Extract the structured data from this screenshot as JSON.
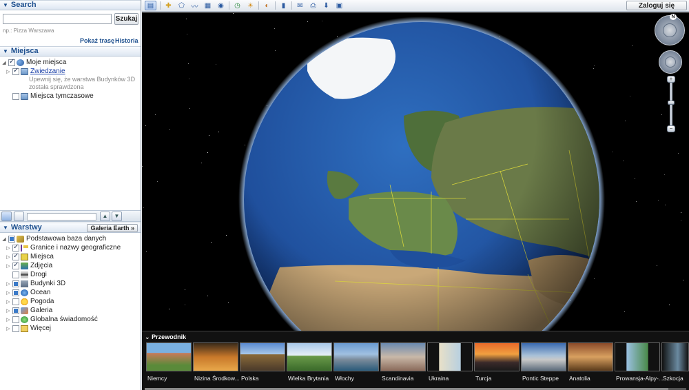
{
  "search": {
    "title": "Search",
    "placeholder": "",
    "button": "Szukaj",
    "hint": "np.: Pizza Warszawa",
    "route_link": "Pokaż trasę",
    "history_link": "Historia"
  },
  "places": {
    "title": "Miejsca",
    "items": [
      {
        "label": "Moje miejsca",
        "checked": true
      },
      {
        "label": "Zwiedzanie",
        "checked": true,
        "link": true
      },
      {
        "label": "Miejsca tymczasowe",
        "checked": false
      }
    ],
    "note_line1": "Upewnij się, że warstwa Budynków 3D",
    "note_line2": "została sprawdzona"
  },
  "layers": {
    "title": "Warstwy",
    "gallery_button": "Galeria Earth »",
    "root": "Podstawowa baza danych",
    "items": [
      {
        "label": "Granice i nazwy geograficzne",
        "checked": true
      },
      {
        "label": "Miejsca",
        "checked": true
      },
      {
        "label": "Zdjęcia",
        "checked": true
      },
      {
        "label": "Drogi",
        "checked": false
      },
      {
        "label": "Budynki 3D",
        "checked": "partial"
      },
      {
        "label": "Ocean",
        "checked": "partial"
      },
      {
        "label": "Pogoda",
        "checked": false
      },
      {
        "label": "Galeria",
        "checked": "partial"
      },
      {
        "label": "Globalna świadomość",
        "checked": false
      },
      {
        "label": "Więcej",
        "checked": false
      }
    ]
  },
  "toolbar": {
    "login": "Zaloguj się"
  },
  "nav": {
    "north": "N",
    "zoom_in": "+",
    "zoom_out": "−"
  },
  "guide": {
    "title": "Przewodnik",
    "tours": [
      "Niemcy",
      "Nizina Środkow...",
      "Polska",
      "Wielka Brytania",
      "Włochy",
      "Scandinavia",
      "Ukraina",
      "Turcja",
      "Pontic Steppe",
      "Anatolia",
      "Prowansja-Alpy-...",
      "Szkocja"
    ]
  },
  "colors": {
    "accent": "#1d4f8e",
    "ocean": "#1f4f9c",
    "land": "#5f7f3f",
    "border": "#e6e23a"
  }
}
